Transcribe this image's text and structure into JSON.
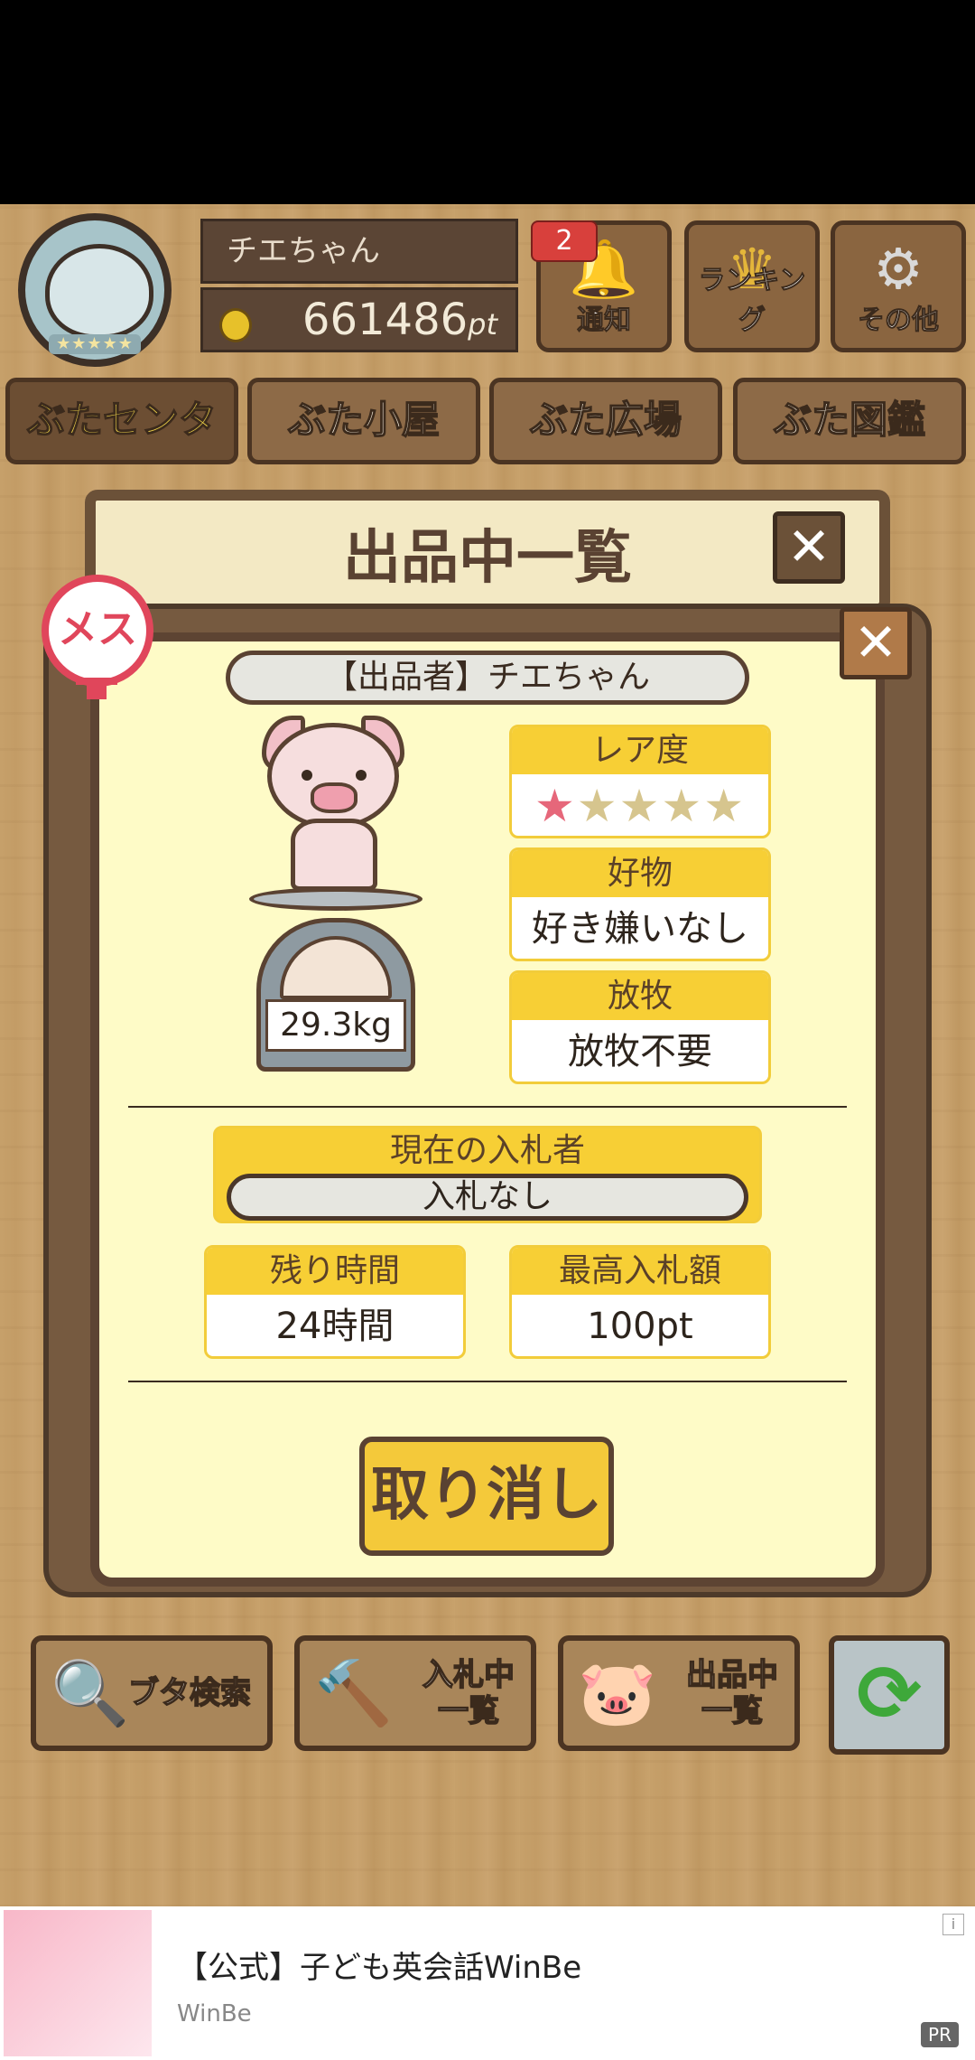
{
  "header": {
    "player_name": "チエちゃん",
    "points_value": "661486",
    "points_unit": "pt",
    "notification_badge": "2",
    "buttons": [
      {
        "label": "通知",
        "icon": "bell-icon"
      },
      {
        "label": "ランキング",
        "icon": "crown-icon"
      },
      {
        "label": "その他",
        "icon": "gear-icon"
      }
    ]
  },
  "tabs": [
    {
      "label": "ぶたセンター",
      "active": true
    },
    {
      "label": "ぶた小屋",
      "active": false
    },
    {
      "label": "ぶた広場",
      "active": false
    },
    {
      "label": "ぶた図鑑",
      "active": false
    }
  ],
  "panel": {
    "title": "出品中一覧",
    "gender_label": "メス",
    "seller": "【出品者】チエちゃん",
    "weight": "29.3kg",
    "rarity": {
      "label": "レア度",
      "stars_on": "★",
      "stars_off": "★★★★"
    },
    "favorite": {
      "label": "好物",
      "value": "好き嫌いなし"
    },
    "grazing": {
      "label": "放牧",
      "value": "放牧不要"
    },
    "current_bidder": {
      "label": "現在の入札者",
      "value": "入札なし"
    },
    "time_left": {
      "label": "残り時間",
      "value": "24時間"
    },
    "highest_bid": {
      "label": "最高入札額",
      "value": "100pt"
    },
    "cancel_label": "取り消し"
  },
  "bottom_nav": [
    {
      "label": "ブタ検索",
      "icon": "magnifier-icon"
    },
    {
      "label": "入札中\n一覧",
      "icon": "gavel-icon"
    },
    {
      "label": "出品中\n一覧",
      "icon": "pig-icon"
    }
  ],
  "ad": {
    "title": "【公式】子ども英会話WinBe",
    "advertiser": "WinBe",
    "pr_label": "PR",
    "info_label": "i"
  }
}
